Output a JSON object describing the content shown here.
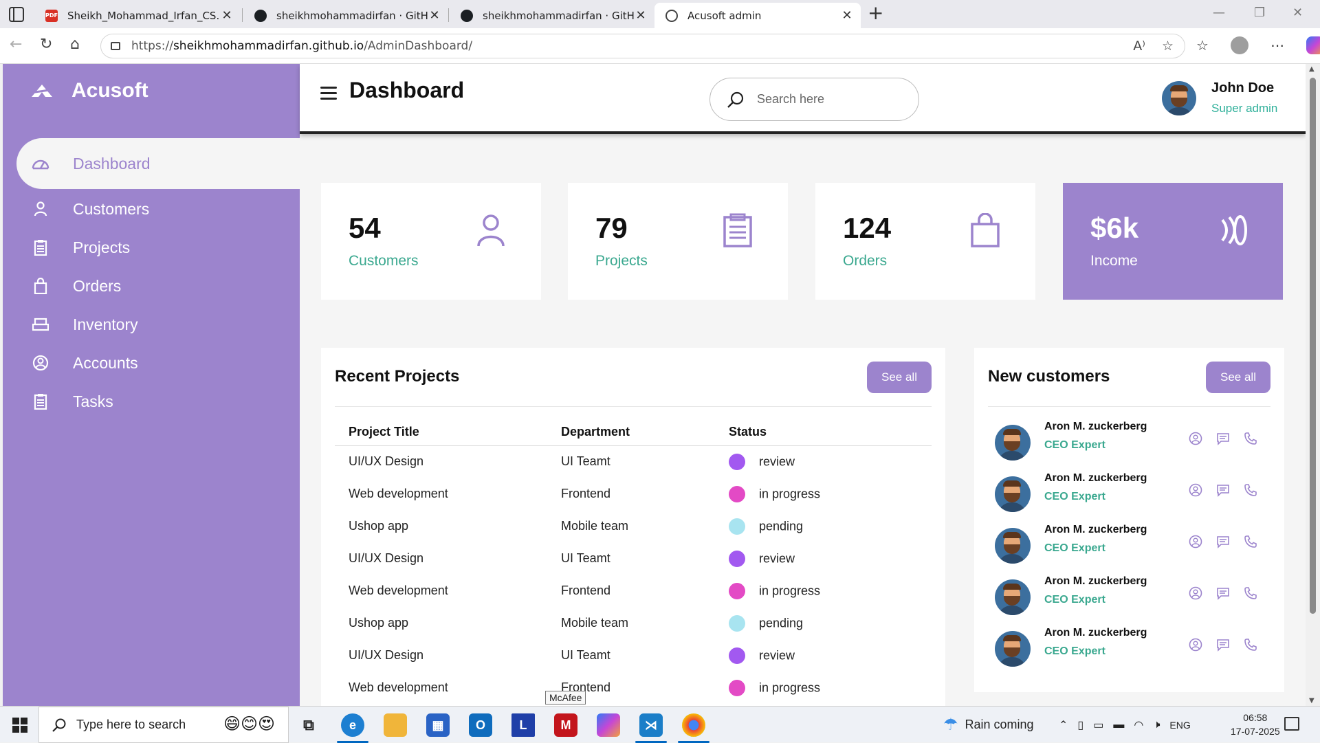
{
  "browser": {
    "tabs": [
      {
        "label": "Sheikh_Mohammad_Irfan_CS.pdf",
        "icon": "pdf-icon"
      },
      {
        "label": "sheikhmohammadirfan · GitHub",
        "icon": "github-icon"
      },
      {
        "label": "sheikhmohammadirfan · GitHub",
        "icon": "github-icon"
      },
      {
        "label": "Acusoft admin",
        "icon": "globe-icon",
        "active": true
      }
    ],
    "url_prefix": "https://",
    "url_host": "sheikhmohammadirfan.github.io",
    "url_path": "/AdminDashboard/"
  },
  "sidebar": {
    "brand": "Acusoft",
    "items": [
      {
        "label": "Dashboard",
        "icon": "dashboard-icon",
        "active": true
      },
      {
        "label": "Customers",
        "icon": "person-icon"
      },
      {
        "label": "Projects",
        "icon": "clipboard-icon"
      },
      {
        "label": "Orders",
        "icon": "bag-icon"
      },
      {
        "label": "Inventory",
        "icon": "inventory-icon"
      },
      {
        "label": "Accounts",
        "icon": "account-icon"
      },
      {
        "label": "Tasks",
        "icon": "tasks-icon"
      }
    ]
  },
  "header": {
    "title": "Dashboard",
    "search_placeholder": "Search here",
    "user_name": "John Doe",
    "user_role": "Super admin"
  },
  "cards": [
    {
      "value": "54",
      "label": "Customers",
      "icon": "person-icon"
    },
    {
      "value": "79",
      "label": "Projects",
      "icon": "clipboard-icon"
    },
    {
      "value": "124",
      "label": "Orders",
      "icon": "bag-icon"
    },
    {
      "value": "$6k",
      "label": "Income",
      "icon": "money-icon"
    }
  ],
  "recent_projects": {
    "title": "Recent Projects",
    "see_all": "See all",
    "columns": [
      "Project Title",
      "Department",
      "Status"
    ],
    "rows": [
      {
        "title": "UI/UX Design",
        "department": "UI Teamt",
        "status": "review",
        "color": "#a259f0"
      },
      {
        "title": "Web development",
        "department": "Frontend",
        "status": "in progress",
        "color": "#e34ac5"
      },
      {
        "title": "Ushop app",
        "department": "Mobile team",
        "status": "pending",
        "color": "#a8e4f0"
      },
      {
        "title": "UI/UX Design",
        "department": "UI Teamt",
        "status": "review",
        "color": "#a259f0"
      },
      {
        "title": "Web development",
        "department": "Frontend",
        "status": "in progress",
        "color": "#e34ac5"
      },
      {
        "title": "Ushop app",
        "department": "Mobile team",
        "status": "pending",
        "color": "#a8e4f0"
      },
      {
        "title": "UI/UX Design",
        "department": "UI Teamt",
        "status": "review",
        "color": "#a259f0"
      },
      {
        "title": "Web development",
        "department": "Frontend",
        "status": "in progress",
        "color": "#e34ac5"
      }
    ]
  },
  "new_customers": {
    "title": "New customers",
    "see_all": "See all",
    "items": [
      {
        "name": "Aron M. zuckerberg",
        "role": "CEO Expert"
      },
      {
        "name": "Aron M. zuckerberg",
        "role": "CEO Expert"
      },
      {
        "name": "Aron M. zuckerberg",
        "role": "CEO Expert"
      },
      {
        "name": "Aron M. zuckerberg",
        "role": "CEO Expert"
      },
      {
        "name": "Aron M. zuckerberg",
        "role": "CEO Expert"
      }
    ]
  },
  "taskbar": {
    "search_placeholder": "Type here to search",
    "tooltip": "McAfee",
    "weather": "Rain coming",
    "language": "ENG",
    "time": "06:58",
    "date": "17-07-2025"
  },
  "colors": {
    "sidebar": "#9c84cd",
    "accent_green": "#3aa88f",
    "status_review": "#a259f0",
    "status_progress": "#e34ac5",
    "status_pending": "#a8e4f0"
  }
}
